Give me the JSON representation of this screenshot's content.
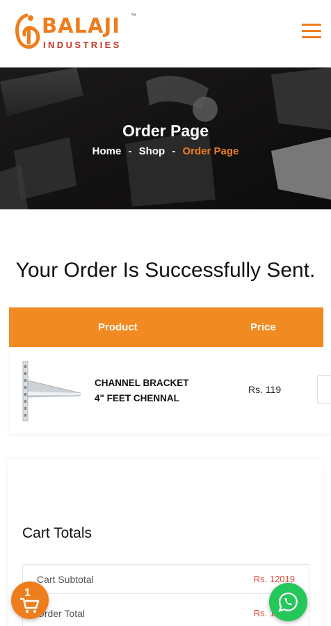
{
  "brand": {
    "name": "BALAJI",
    "tm": "™",
    "sub": "INDUSTRIES",
    "primary_color": "#ee7d1d",
    "secondary_color": "#c43326"
  },
  "header": {
    "menu_icon": "hamburger-menu-icon"
  },
  "banner": {
    "title": "Order Page",
    "breadcrumb": {
      "home": "Home",
      "separator": "-",
      "shop": "Shop",
      "current": "Order Page"
    }
  },
  "heading": "Your Order Is Successfully Sent.",
  "order_table": {
    "columns": {
      "product": "Product",
      "price": "Price"
    },
    "rows": [
      {
        "name_line1": "CHANNEL BRACKET",
        "name_line2": "4\" FEET CHENNAL",
        "price": "Rs. 119",
        "image_icon": "channel-bracket-image"
      }
    ]
  },
  "cart_totals": {
    "title": "Cart Totals",
    "rows": [
      {
        "label": "Cart Subtotal",
        "value": "Rs. 12019"
      },
      {
        "label": "Order Total",
        "value": "Rs. 12019"
      }
    ]
  },
  "floating": {
    "cart_count": "1",
    "cart_icon": "shopping-cart-icon",
    "whatsapp_icon": "whatsapp-icon"
  }
}
